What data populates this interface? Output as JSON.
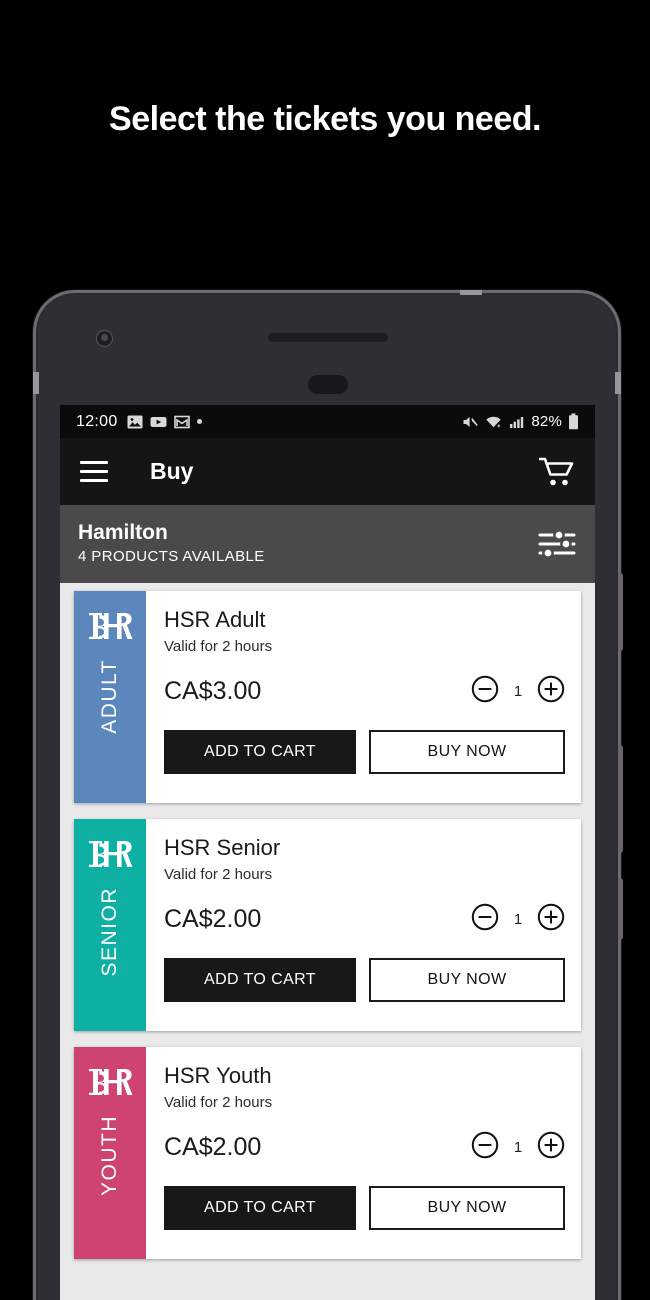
{
  "headline": "Select the tickets you need.",
  "status_bar": {
    "time": "12:00",
    "battery_percent": "82%",
    "left_icons": [
      "photos-icon",
      "youtube-icon",
      "gmail-icon",
      "notification-dot-icon"
    ],
    "right_icons": [
      "mute-icon",
      "wifi-icon",
      "cellular-signal-icon",
      "battery-icon"
    ]
  },
  "app_bar": {
    "menu_icon": "hamburger-menu-icon",
    "title": "Buy",
    "cart_icon": "shopping-cart-icon"
  },
  "section": {
    "title": "Hamilton",
    "subtitle": "4 PRODUCTS AVAILABLE",
    "filter_icon": "tune-filter-icon"
  },
  "labels": {
    "add_to_cart": "ADD TO CART",
    "buy_now": "BUY NOW",
    "decrement_icon": "minus-circle-icon",
    "increment_icon": "plus-circle-icon",
    "brand_logo": "hsr-monogram-logo"
  },
  "colors": {
    "adult": "#5B87BC",
    "senior": "#0DB0A3",
    "youth": "#CF4370",
    "app_bar": "#151515",
    "section_bar": "#4A4A4A",
    "page_background": "#E9E9E9",
    "primary_button": "#181818"
  },
  "products": [
    {
      "category": "ADULT",
      "color": "#5B87BC",
      "name": "HSR Adult",
      "description": "Valid for 2 hours",
      "price": "CA$3.00",
      "quantity": "1"
    },
    {
      "category": "SENIOR",
      "color": "#0DB0A3",
      "name": "HSR Senior",
      "description": "Valid for 2 hours",
      "price": "CA$2.00",
      "quantity": "1"
    },
    {
      "category": "YOUTH",
      "color": "#CF4370",
      "name": "HSR Youth",
      "description": "Valid for 2 hours",
      "price": "CA$2.00",
      "quantity": "1"
    }
  ]
}
